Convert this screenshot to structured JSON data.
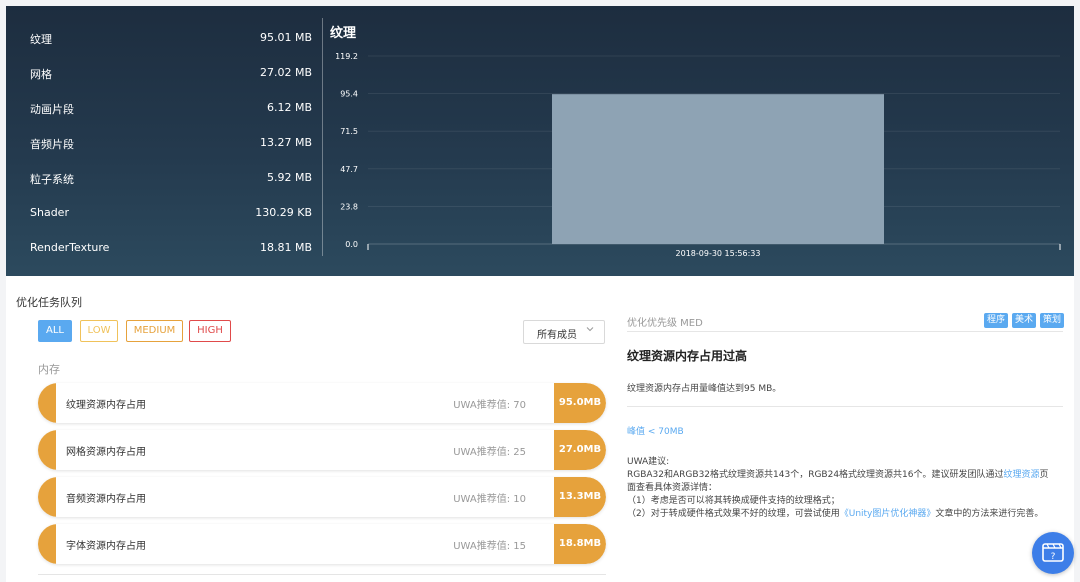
{
  "stats": [
    {
      "label": "纹理",
      "value": "95.01 MB"
    },
    {
      "label": "网格",
      "value": "27.02 MB"
    },
    {
      "label": "动画片段",
      "value": "6.12 MB"
    },
    {
      "label": "音频片段",
      "value": "13.27 MB"
    },
    {
      "label": "粒子系统",
      "value": "5.92 MB"
    },
    {
      "label": "Shader",
      "value": "130.29 KB"
    },
    {
      "label": "RenderTexture",
      "value": "18.81 MB"
    }
  ],
  "chart_data": {
    "type": "bar",
    "title": "纹理",
    "categories": [
      "2018-09-30 15:56:33"
    ],
    "values": [
      95.0
    ],
    "yticks": [
      "0.0",
      "23.8",
      "47.7",
      "71.5",
      "95.4",
      "119.2"
    ],
    "ylim": [
      0,
      119.2
    ],
    "grid": true,
    "bar_color": "#8ea3b4"
  },
  "queue": {
    "title": "优化任务队列",
    "filters": {
      "all": "ALL",
      "low": "LOW",
      "medium": "MEDIUM",
      "high": "HIGH"
    },
    "member_select": "所有成员",
    "category": "内存",
    "tasks": [
      {
        "name": "纹理资源内存占用",
        "recommend": "UWA推荐值: 70",
        "value": "95.0MB"
      },
      {
        "name": "网格资源内存占用",
        "recommend": "UWA推荐值: 25",
        "value": "27.0MB"
      },
      {
        "name": "音频资源内存占用",
        "recommend": "UWA推荐值: 10",
        "value": "13.3MB"
      },
      {
        "name": "字体资源内存占用",
        "recommend": "UWA推荐值: 15",
        "value": "18.8MB"
      }
    ]
  },
  "detail": {
    "priority": "优化优先级 MED",
    "tags": [
      "程序",
      "美术",
      "策划"
    ],
    "title": "纹理资源内存占用过高",
    "description": "纹理资源内存占用量峰值达到95 MB。",
    "peak": "峰值 < 70MB",
    "suggestion_heading": "UWA建议:",
    "line1_a": "RGBA32和ARGB32格式纹理资源共143个，RGB24格式纹理资源共16个。建议研发团队通过",
    "line1_link": "纹理资源",
    "line1_b": "页",
    "line2": "面查看具体资源详情：",
    "line3": "（1）考虑是否可以将其转换成硬件支持的纹理格式；",
    "line4_a": "（2）对于转成硬件格式效果不好的纹理，可尝试使用",
    "line4_link": "《Unity图片优化神器》",
    "line4_b": "文章中的方法来进行完善。"
  },
  "colors": {
    "accent": "#5aa9f0",
    "warning": "#e6a23c",
    "danger": "#e04a4a",
    "low": "#f0c25a"
  },
  "icons": {
    "help": "film-question-icon",
    "select": "chevron-down-icon"
  }
}
